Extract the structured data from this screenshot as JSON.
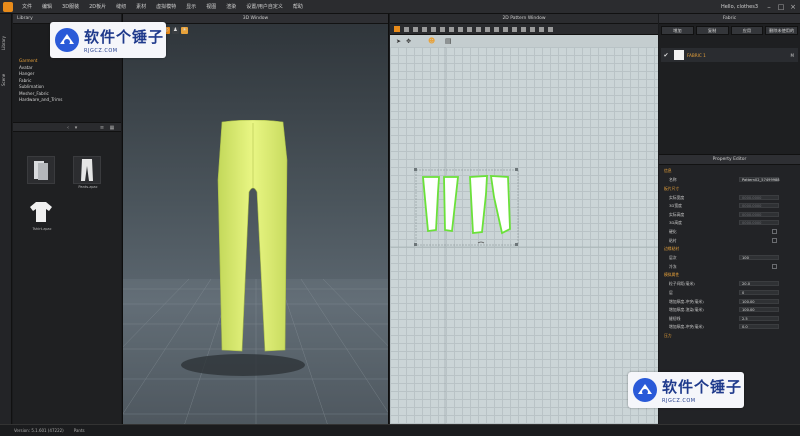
{
  "menu": {
    "items": [
      "文件",
      "编辑",
      "3D服装",
      "2D板片",
      "缝纫",
      "素材",
      "虚拟模特",
      "显示",
      "视图",
      "渲染",
      "设置/用户自定义",
      "帮助"
    ],
    "user": "Hello, clothes3"
  },
  "side_tabs": [
    "Library",
    "Scene"
  ],
  "library": {
    "header": "Library",
    "items": [
      "Garment",
      "Avatar",
      "Hanger",
      "Fabric",
      "Sublimation",
      "Mesher_Fabric",
      "Hardware_and_Trims"
    ],
    "active_index": 0,
    "thumbs": [
      {
        "label": "",
        "kind": "folder"
      },
      {
        "label": "Pants.zpac",
        "kind": "pants"
      },
      {
        "label": "Tshirt.zpac",
        "kind": "tshirt"
      }
    ]
  },
  "watermark": {
    "title": "软件个锤子",
    "url": "RJGCZ.COM"
  },
  "window3d": {
    "title": "3D Window"
  },
  "window2d": {
    "title": "2D Pattern Window"
  },
  "fabric": {
    "header": "Fabric",
    "buttons": [
      "增加",
      "复制",
      "应用",
      "删除未使用的"
    ],
    "items": [
      {
        "name": "FABRIC 1",
        "mark": "M"
      }
    ]
  },
  "property_editor": {
    "header": "Property Editor",
    "rows": [
      {
        "label": "信息",
        "type": "section"
      },
      {
        "label": "名称",
        "value": "Pattern02_57499988",
        "type": "value"
      },
      {
        "label": "板片尺寸",
        "type": "section"
      },
      {
        "label": "实际宽度",
        "value": "0000.0000",
        "type": "dim"
      },
      {
        "label": "3D宽度",
        "value": "0000.0000",
        "type": "dim"
      },
      {
        "label": "实际高度",
        "value": "0000.0000",
        "type": "dim"
      },
      {
        "label": "3D高度",
        "value": "0000.0000",
        "type": "dim"
      },
      {
        "label": "硬化",
        "type": "checkbox"
      },
      {
        "label": "粘衬",
        "type": "checkbox"
      },
      {
        "label": "边缘粘衬",
        "type": "section"
      },
      {
        "label": "层次",
        "value": "100",
        "type": "value"
      },
      {
        "label": "冷冻",
        "type": "checkbox"
      },
      {
        "label": "模拟属性",
        "type": "section"
      },
      {
        "label": "粒子间距(毫米)",
        "value": "20.0",
        "type": "value"
      },
      {
        "label": "层",
        "value": "0",
        "type": "value"
      },
      {
        "label": "增加厚度-冲突(毫米)",
        "value": "100.00",
        "type": "value"
      },
      {
        "label": "增加厚度-渲染(毫米)",
        "value": "100.00",
        "type": "value"
      },
      {
        "label": "缝纫线",
        "value": "2.5",
        "type": "value"
      },
      {
        "label": "增加厚度-冲突(毫米)",
        "value": "0.0",
        "type": "value"
      },
      {
        "label": "压力",
        "type": "section"
      }
    ]
  },
  "status": {
    "version": "Version: 5.1.601 (47222)",
    "scene": "Pants"
  },
  "colors": {
    "accent": "#e88b1a",
    "garment": "#e4f27c",
    "pattern_outline": "#6be13a"
  }
}
